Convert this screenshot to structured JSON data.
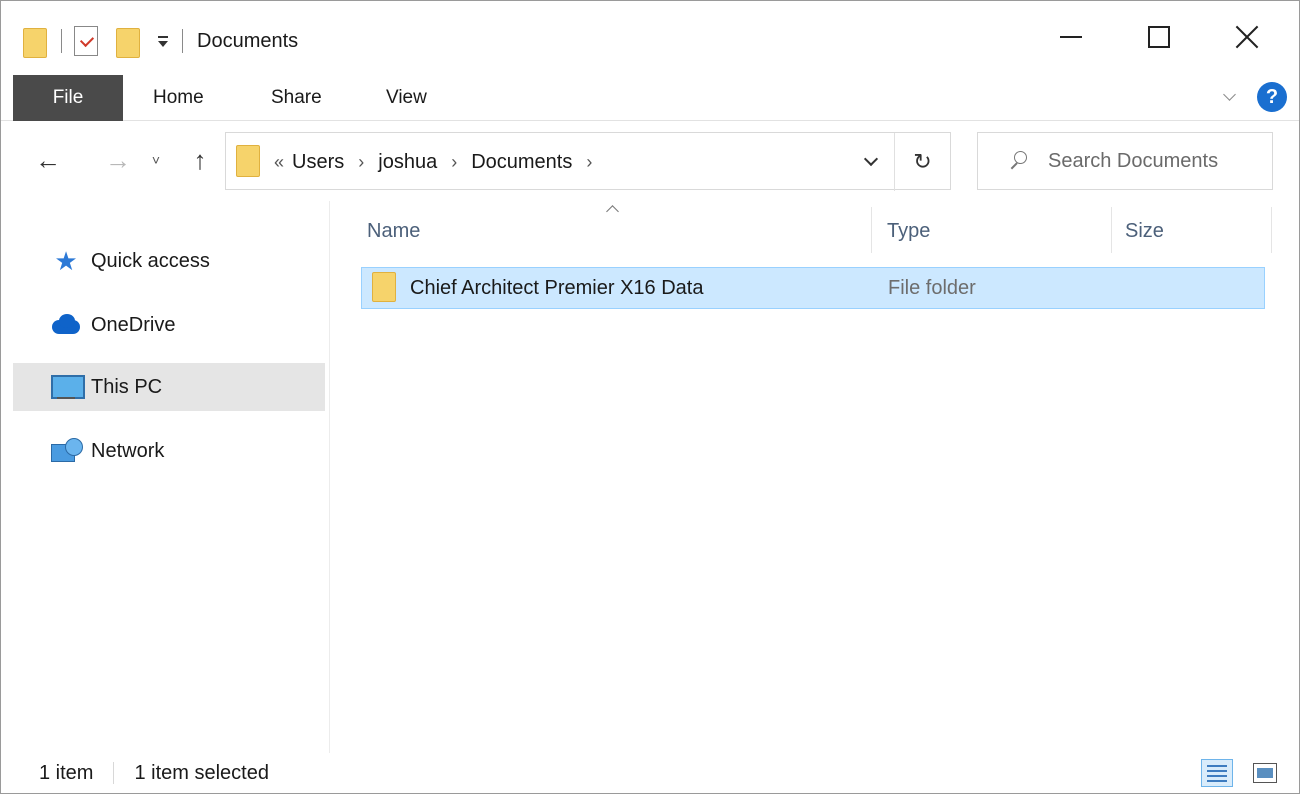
{
  "window": {
    "title": "Documents",
    "controls": {
      "minimize": "minimize-icon",
      "maximize": "maximize-icon",
      "close": "close-icon"
    }
  },
  "ribbon": {
    "tabs": [
      {
        "label": "File",
        "active": true
      },
      {
        "label": "Home"
      },
      {
        "label": "Share"
      },
      {
        "label": "View"
      }
    ],
    "help_label": "?"
  },
  "nav": {
    "back_glyph": "←",
    "forward_glyph": "→",
    "recent_glyph": "˅",
    "up_glyph": "↑",
    "refresh_glyph": "↻"
  },
  "address": {
    "overflow": "«",
    "breadcrumbs": [
      "Users",
      "joshua",
      "Documents"
    ],
    "separator": "›"
  },
  "search": {
    "placeholder": "Search Documents"
  },
  "sidebar": {
    "items": [
      {
        "label": "Quick access",
        "icon": "star-icon"
      },
      {
        "label": "OneDrive",
        "icon": "cloud-icon"
      },
      {
        "label": "This PC",
        "icon": "computer-icon",
        "selected": true
      },
      {
        "label": "Network",
        "icon": "network-icon"
      }
    ]
  },
  "list": {
    "columns": {
      "name": "Name",
      "type": "Type",
      "size": "Size"
    },
    "rows": [
      {
        "name": "Chief Architect Premier X16 Data",
        "type": "File folder",
        "size": "",
        "selected": true
      }
    ]
  },
  "status": {
    "count": "1 item",
    "selection": "1 item selected"
  },
  "colors": {
    "accent": "#0078d7",
    "selection_bg": "#cce8ff",
    "selection_border": "#99d1ff",
    "file_tab_bg": "#4a4a4a",
    "folder_yellow": "#f6d36b"
  }
}
